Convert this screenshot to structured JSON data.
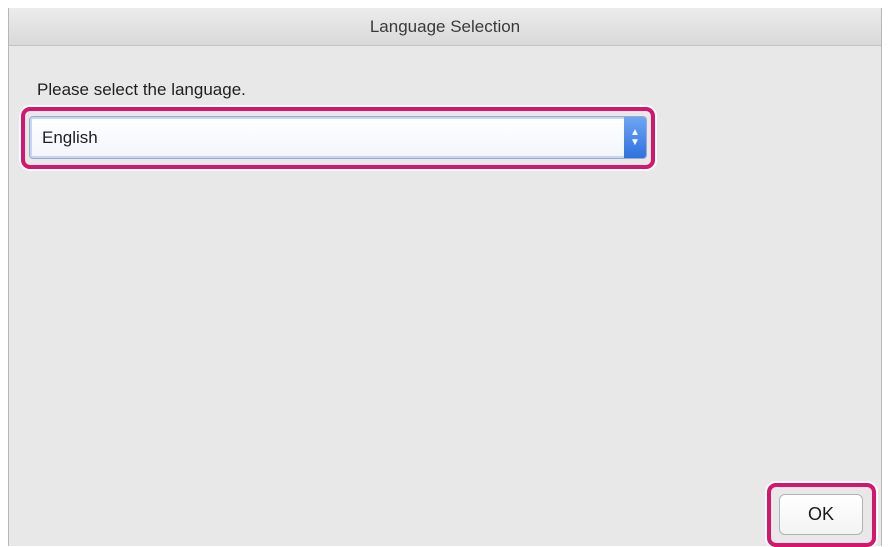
{
  "window": {
    "title": "Language Selection"
  },
  "prompt": {
    "text": "Please select the language."
  },
  "language_select": {
    "selected_value": "English"
  },
  "actions": {
    "ok_label": "OK"
  },
  "colors": {
    "highlight": "#d6156e",
    "select_arrow": "#3b7fe6",
    "window_background": "#e8e8e8"
  }
}
